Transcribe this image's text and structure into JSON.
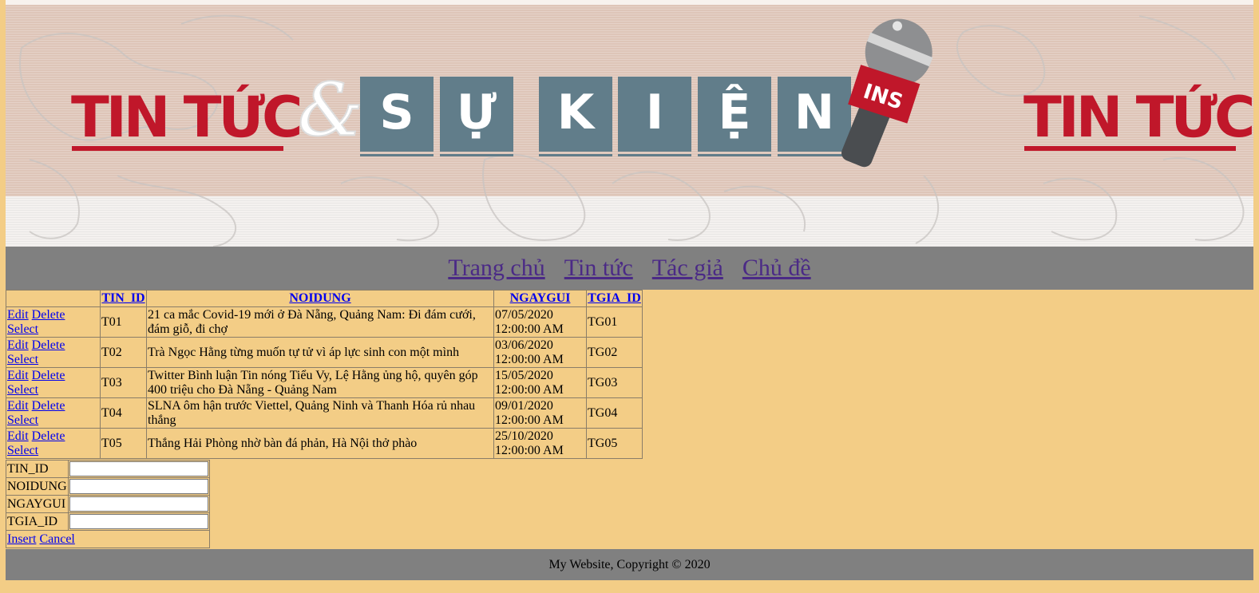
{
  "banner": {
    "left_brand": "TIN TỨC",
    "ampersand": "&",
    "tiles": [
      "S",
      "Ự",
      "K",
      "I",
      "Ệ",
      "N"
    ],
    "mic_tag": "INS",
    "right_brand": "TIN TỨC"
  },
  "nav": {
    "items": [
      "Trang chủ",
      "Tin tức",
      "Tác giả",
      "Chủ đề"
    ]
  },
  "grid": {
    "headers": [
      "TIN_ID",
      "NOIDUNG",
      "NGAYGUI",
      "TGIA_ID"
    ],
    "row_actions": [
      "Edit",
      "Delete",
      "Select"
    ],
    "rows": [
      {
        "tin_id": "T01",
        "noidung": "21 ca mắc Covid-19 mới ở Đà Nẵng, Quảng Nam: Đi đám cưới, đám giỗ, đi chợ",
        "ngaygui": "07/05/2020 12:00:00 AM",
        "tgia_id": "TG01"
      },
      {
        "tin_id": "T02",
        "noidung": "Trà Ngọc Hằng từng muốn tự tử vì áp lực sinh con một mình",
        "ngaygui": "03/06/2020 12:00:00 AM",
        "tgia_id": "TG02"
      },
      {
        "tin_id": "T03",
        "noidung": "Twitter Bình luận Tin nóng Tiểu Vy, Lệ Hằng ủng hộ, quyên góp 400 triệu cho Đà Nẵng - Quảng Nam",
        "ngaygui": "15/05/2020 12:00:00 AM",
        "tgia_id": "TG03"
      },
      {
        "tin_id": "T04",
        "noidung": "SLNA ôm hận trước Viettel, Quảng Ninh và Thanh Hóa rủ nhau thắng",
        "ngaygui": "09/01/2020 12:00:00 AM",
        "tgia_id": "TG04"
      },
      {
        "tin_id": "T05",
        "noidung": "Thắng Hải Phòng nhờ bàn đá phản, Hà Nội thở phào",
        "ngaygui": "25/10/2020 12:00:00 AM",
        "tgia_id": "TG05"
      }
    ]
  },
  "form": {
    "fields": [
      {
        "label": "TIN_ID",
        "value": ""
      },
      {
        "label": "NOIDUNG",
        "value": ""
      },
      {
        "label": "NGAYGUI",
        "value": ""
      },
      {
        "label": "TGIA_ID",
        "value": ""
      }
    ],
    "insert_label": "Insert",
    "cancel_label": "Cancel"
  },
  "footer": {
    "text": "My Website, Copyright © 2020"
  },
  "colors": {
    "page_bg": "#f3cd86",
    "bar_gray": "#808080",
    "brand_red": "#c0172a",
    "tile_blue": "#617d8a",
    "nav_link": "#4b2a86",
    "link": "#0000ee"
  }
}
